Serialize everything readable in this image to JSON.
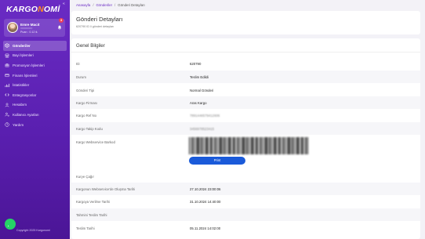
{
  "brand": {
    "logo_part1": "KARGO",
    "logo_part2": "N",
    "logo_part3": "OMİ",
    "accent": "#ff8a1f",
    "primary": "#6a2bc4"
  },
  "user": {
    "name": "Emre Macit",
    "subtitle": "••••••••••••",
    "balance": "Puan : 0.12 ₺",
    "notification_count": "3"
  },
  "sidebar": {
    "collapse_icon": "double-chevron-left",
    "items": [
      {
        "label": "Gönderiler",
        "icon": "package-icon",
        "active": true
      },
      {
        "label": "Bayi İşlemleri",
        "icon": "store-icon"
      },
      {
        "label": "Promosyon İşlemleri",
        "icon": "gift-icon"
      },
      {
        "label": "Finans İşlemleri",
        "icon": "card-icon"
      },
      {
        "label": "İstatistikler",
        "icon": "chart-icon"
      },
      {
        "label": "Entegrasyonlar",
        "icon": "code-icon"
      },
      {
        "label": "Hesabım",
        "icon": "user-icon"
      },
      {
        "label": "Kullanıcı Ayarları",
        "icon": "user-cog-icon"
      },
      {
        "label": "Yardım",
        "icon": "help-icon"
      }
    ],
    "copyright": "Copyright 2025 Kargonomi"
  },
  "breadcrumb": {
    "home": "Anasayfa",
    "section": "Gönderiler",
    "current": "Gönderi Detayları"
  },
  "header": {
    "title": "Gönderi Detayları",
    "subtitle": "620790 ID li gönderi detayları"
  },
  "details": {
    "title": "Genel Bilgiler",
    "rows": [
      {
        "label": "ID:",
        "value": "620790"
      },
      {
        "label": "Durum",
        "value": "Teslim Edildi"
      },
      {
        "label": "Gönderi Tipi",
        "value": "Normal Gönderi"
      },
      {
        "label": "Kargo Firması",
        "value": "Aras Kargo"
      },
      {
        "label": "Kargo Ref No",
        "value": "7891446579412606"
      },
      {
        "label": "Kargo Takip Kodu",
        "value": "3456978523415"
      },
      {
        "label": "Kargo Webservice Barkod",
        "value": ""
      },
      {
        "label": "Kurye Çağır",
        "value": ""
      },
      {
        "label": "Kargonun Webservice'de Oluşma Tarihi",
        "value": "27.10.2024 23:00:06"
      },
      {
        "label": "Kargoya Verilme Tarihi",
        "value": "31.10.2024 14:40:00"
      },
      {
        "label": "Tahmini Teslim Tarihi",
        "value": ""
      },
      {
        "label": "Teslim Tarihi",
        "value": "05.11.2024 14:02:00"
      }
    ],
    "print_label": "Print"
  }
}
